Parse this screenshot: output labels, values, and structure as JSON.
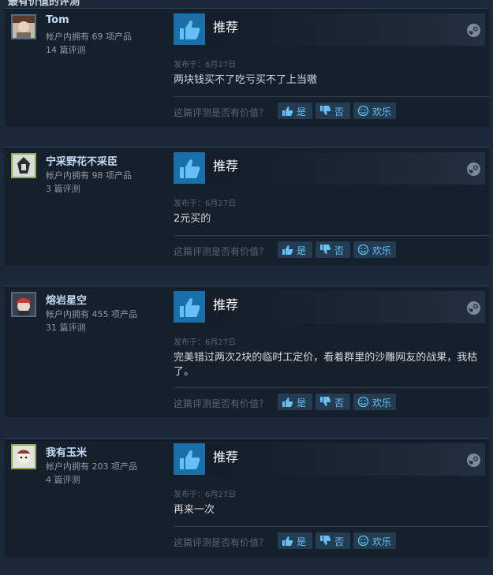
{
  "header": {
    "partial_title": "最有价值的评测"
  },
  "helpful_prompt": "这篇评测是否有价值？",
  "buttons": {
    "yes": "是",
    "no": "否",
    "funny": "欢乐"
  },
  "reviews": [
    {
      "author": "Tom",
      "owned": "帐户内拥有 69 项产品",
      "review_count": "14 篇评测",
      "verdict": "推荐",
      "date": "发布于：6月27日",
      "text": "两块钱买不了吃亏买不了上当嗷"
    },
    {
      "author": "宁采野花不采臣",
      "owned": "帐户内拥有 98 项产品",
      "review_count": "3 篇评测",
      "verdict": "推荐",
      "date": "发布于：6月27日",
      "text": "2元买的"
    },
    {
      "author": "熔岩星空",
      "owned": "帐户内拥有 455 项产品",
      "review_count": "31 篇评测",
      "verdict": "推荐",
      "date": "发布于：6月27日",
      "text": "完美错过两次2块的临时工定价，看着群里的沙雕网友的战果，我枯了。"
    },
    {
      "author": "我有玉米",
      "owned": "帐户内拥有 203 项产品",
      "review_count": "4 篇评测",
      "verdict": "推荐",
      "date": "发布于：6月27日",
      "text": "再来一次"
    }
  ]
}
